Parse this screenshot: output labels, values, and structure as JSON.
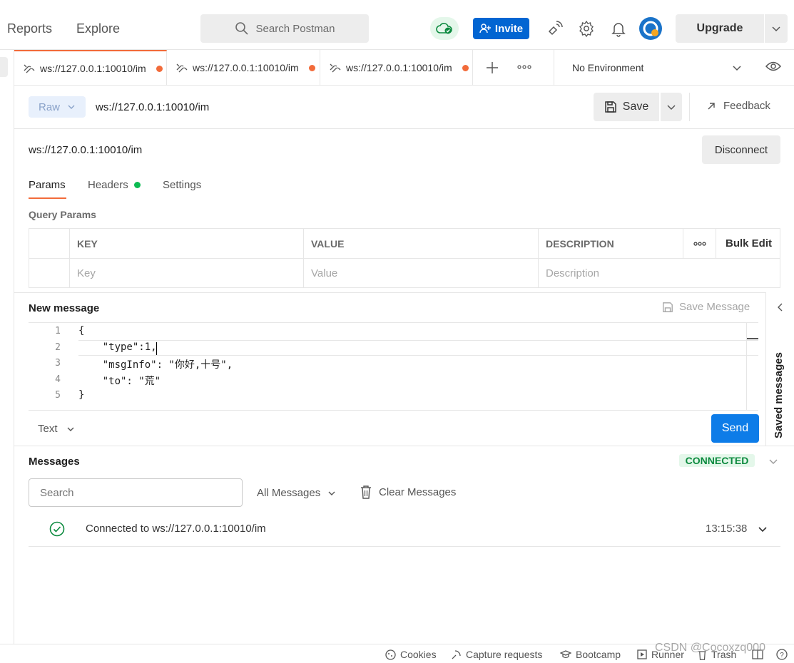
{
  "header": {
    "nav": [
      "Reports",
      "Explore"
    ],
    "search_placeholder": "Search Postman",
    "invite_label": "Invite",
    "upgrade_label": "Upgrade"
  },
  "tabs": [
    {
      "label": "ws://127.0.0.1:10010/im",
      "unsaved": true,
      "active": true
    },
    {
      "label": "ws://127.0.0.1:10010/im",
      "unsaved": true,
      "active": false
    },
    {
      "label": "ws://127.0.0.1:10010/im",
      "unsaved": true,
      "active": false
    }
  ],
  "environment": "No Environment",
  "request": {
    "mode": "Raw",
    "url": "ws://127.0.0.1:10010/im",
    "save_label": "Save",
    "feedback_label": "Feedback",
    "connection_url": "ws://127.0.0.1:10010/im",
    "disconnect_label": "Disconnect"
  },
  "param_tabs": [
    "Params",
    "Headers",
    "Settings"
  ],
  "query_params": {
    "title": "Query Params",
    "headers": {
      "key": "KEY",
      "value": "VALUE",
      "description": "DESCRIPTION",
      "bulk_edit": "Bulk Edit"
    },
    "placeholders": {
      "key": "Key",
      "value": "Value",
      "description": "Description"
    }
  },
  "new_message": {
    "title": "New message",
    "save_message_label": "Save Message",
    "lines": [
      "{",
      "    \"type\":1,",
      "    \"msgInfo\": \"你好,十号\",",
      "    \"to\": \"荒\"",
      "}"
    ],
    "line_numbers": [
      "1",
      "2",
      "3",
      "4",
      "5"
    ],
    "format": "Text",
    "send_label": "Send",
    "saved_messages_label": "Saved messages"
  },
  "messages": {
    "title": "Messages",
    "status": "CONNECTED",
    "search_placeholder": "Search",
    "filter_label": "All Messages",
    "clear_label": "Clear Messages",
    "items": [
      {
        "text": "Connected to ws://127.0.0.1:10010/im",
        "time": "13:15:38"
      }
    ]
  },
  "footer": {
    "items": [
      "Cookies",
      "Capture requests",
      "Bootcamp",
      "Runner",
      "Trash"
    ],
    "watermark": "CSDN @Cocoxzq000"
  },
  "colors": {
    "accent": "#f26b3a",
    "invite": "#0265d2",
    "send": "#0d7ce8",
    "connected": "#0b8a3e"
  }
}
